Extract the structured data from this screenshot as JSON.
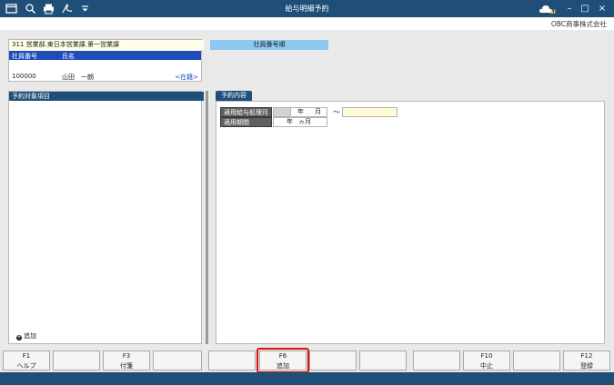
{
  "window": {
    "title": "給与明細予約",
    "company": "OBC商事株式会社",
    "toolbar_icons": [
      "window-icon",
      "search-zoom-icon",
      "print-icon",
      "pdf-icon",
      "dropdown-icon"
    ],
    "controls": {
      "minimize": "–",
      "maximize": "□",
      "close": "×"
    }
  },
  "employee": {
    "department": "311 営業部.東日本営業課.第一営業課",
    "columns": [
      "社員番号",
      "氏名"
    ],
    "id": "100000",
    "name": "山田　一朗",
    "status": "<在籍>"
  },
  "sort_label": "社員番号順",
  "left_panel": {
    "header": "予約対象項目",
    "add_label": "追加"
  },
  "right_panel": {
    "tab": "予約内容",
    "rows": [
      {
        "label": "適用給与処理月",
        "year_unit": "年",
        "month_unit": "月",
        "tilde": "〜"
      },
      {
        "label": "適用期間",
        "year_unit": "年",
        "month_unit": "ヵ月"
      }
    ]
  },
  "fkeys": [
    {
      "code": "F1",
      "label": "ヘルプ"
    },
    {
      "code": "",
      "label": ""
    },
    {
      "code": "F3",
      "label": "付箋"
    },
    {
      "code": "",
      "label": ""
    },
    {
      "code": "",
      "label": ""
    },
    {
      "code": "F6",
      "label": "追加"
    },
    {
      "code": "",
      "label": ""
    },
    {
      "code": "",
      "label": ""
    },
    {
      "code": "",
      "label": ""
    },
    {
      "code": "F10",
      "label": "中止"
    },
    {
      "code": "",
      "label": ""
    },
    {
      "code": "F12",
      "label": "登録"
    }
  ],
  "colors": {
    "titlebar": "#1f4e79",
    "accent": "#1f4db8",
    "highlight": "#e01010"
  }
}
